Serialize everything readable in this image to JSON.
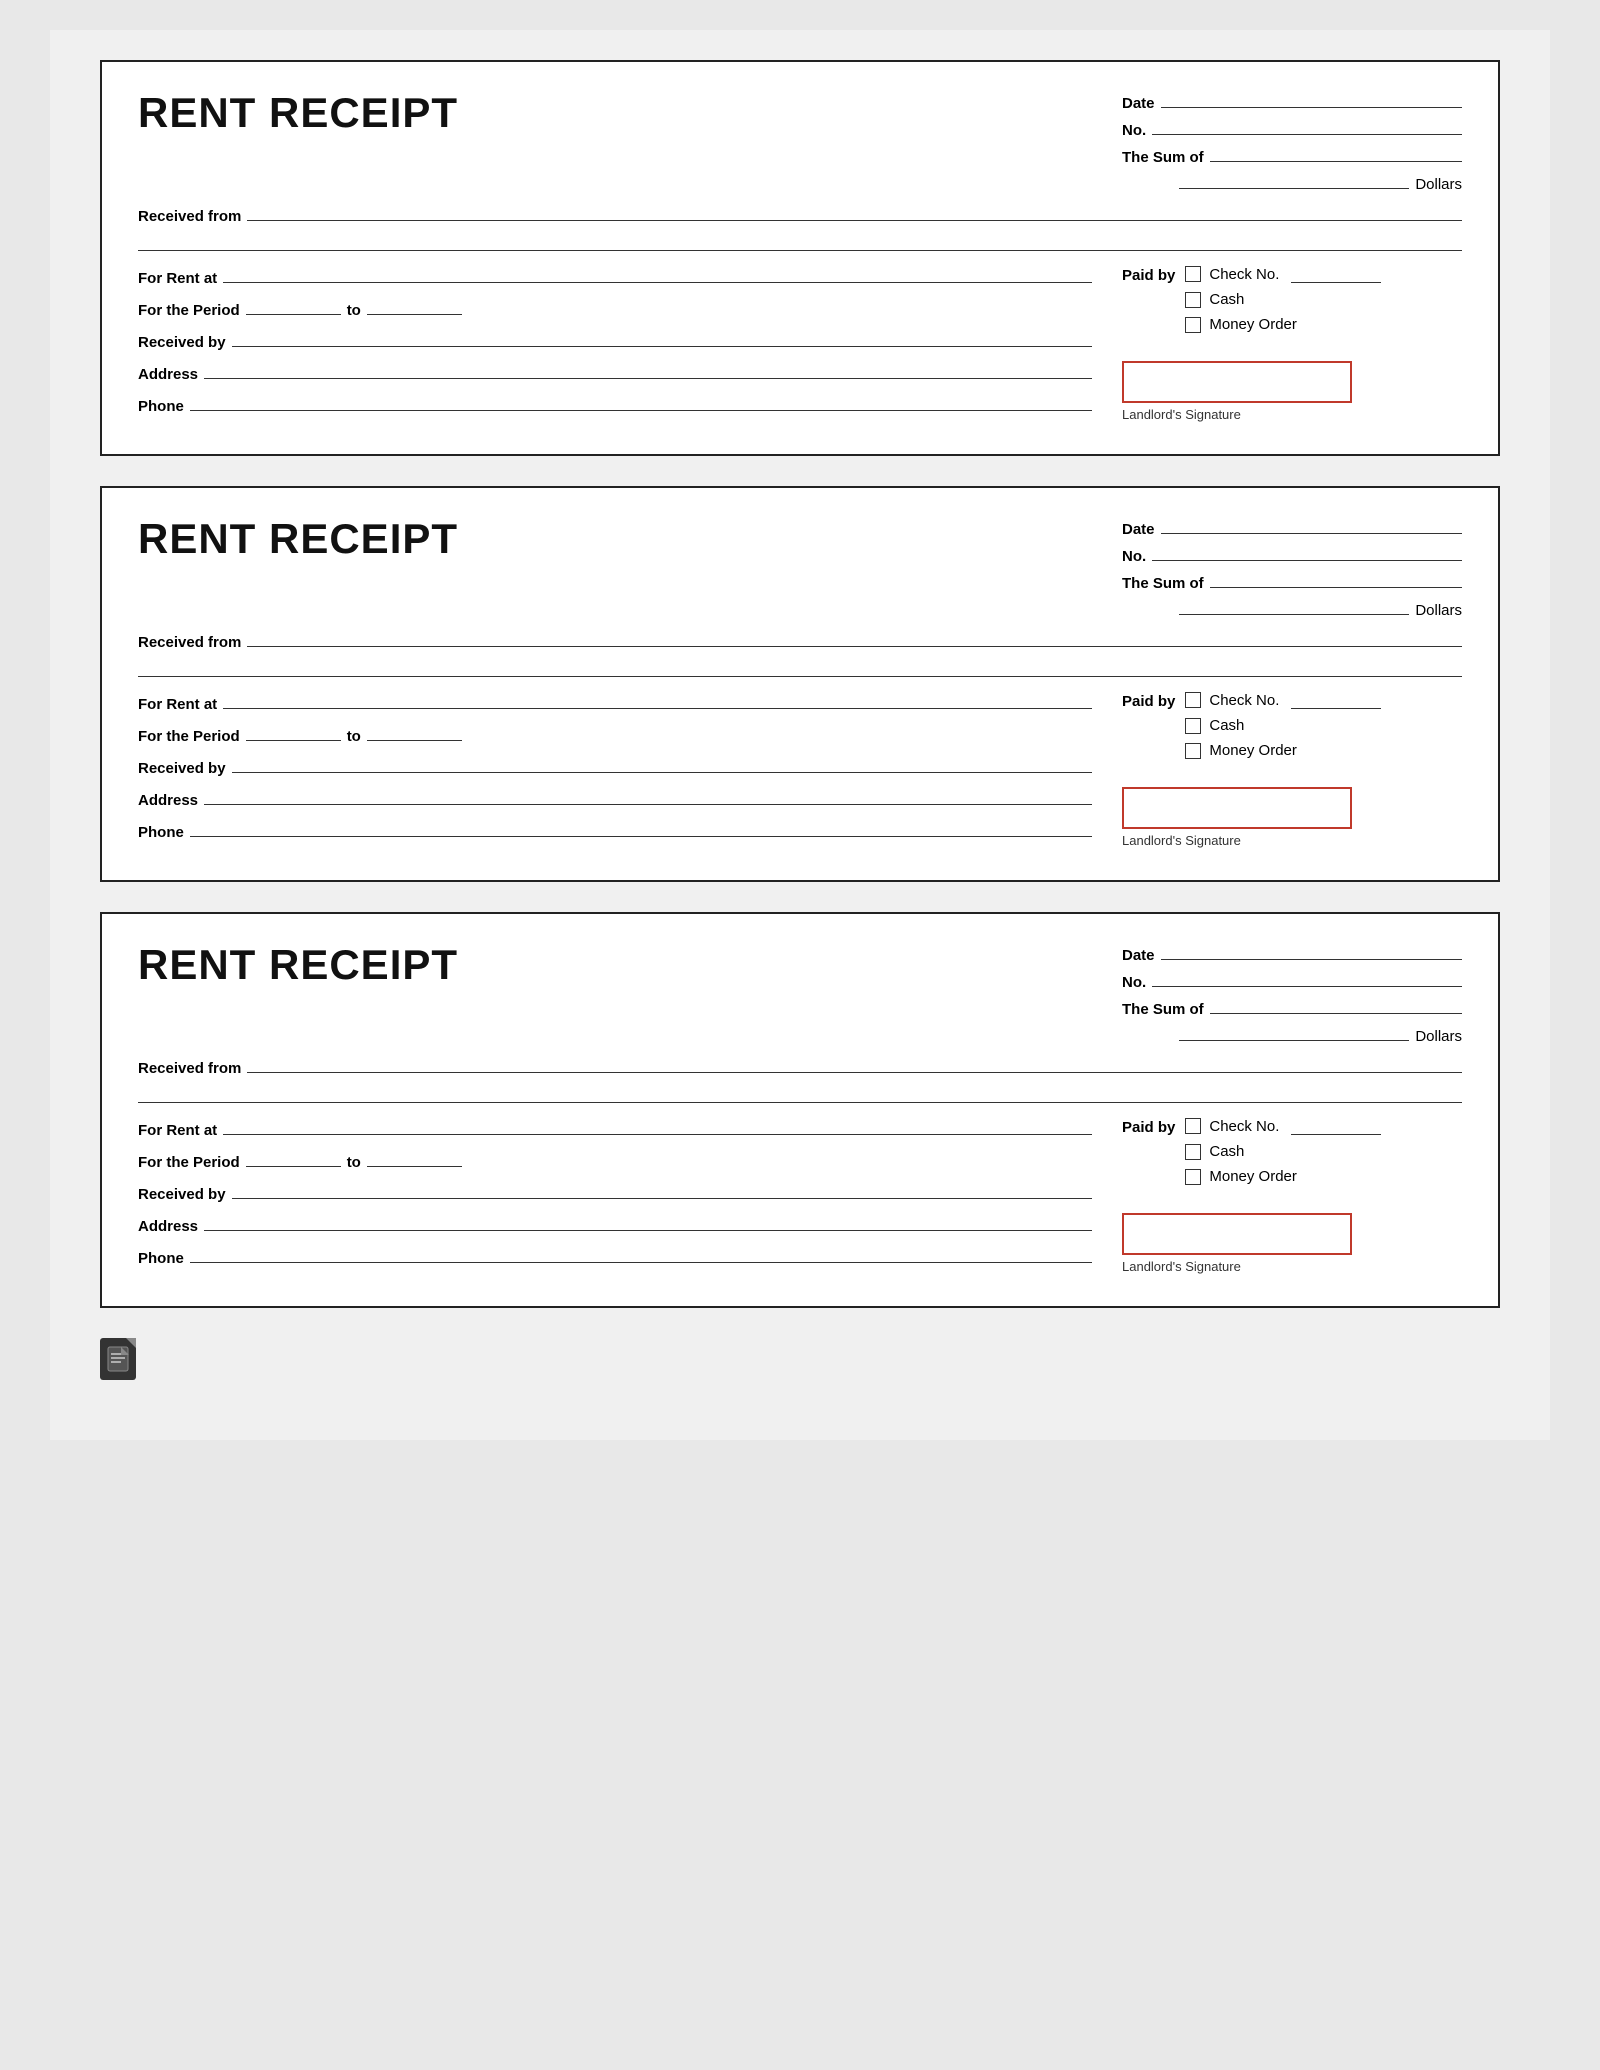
{
  "receipts": [
    {
      "id": 1,
      "title": "RENT RECEIPT",
      "date_label": "Date",
      "no_label": "No.",
      "sum_label": "The Sum of",
      "dollars_label": "Dollars",
      "received_from_label": "Received from",
      "for_rent_at_label": "For Rent at",
      "for_the_period_label": "For the Period",
      "to_label": "to",
      "received_by_label": "Received by",
      "address_label": "Address",
      "phone_label": "Phone",
      "paid_by_label": "Paid by",
      "check_no_label": "Check No.",
      "cash_label": "Cash",
      "money_order_label": "Money Order",
      "landlord_sig_label": "Landlord's Signature"
    },
    {
      "id": 2,
      "title": "RENT RECEIPT",
      "date_label": "Date",
      "no_label": "No.",
      "sum_label": "The Sum of",
      "dollars_label": "Dollars",
      "received_from_label": "Received from",
      "for_rent_at_label": "For Rent at",
      "for_the_period_label": "For the Period",
      "to_label": "to",
      "received_by_label": "Received by",
      "address_label": "Address",
      "phone_label": "Phone",
      "paid_by_label": "Paid by",
      "check_no_label": "Check No.",
      "cash_label": "Cash",
      "money_order_label": "Money Order",
      "landlord_sig_label": "Landlord's Signature"
    },
    {
      "id": 3,
      "title": "RENT RECEIPT",
      "date_label": "Date",
      "no_label": "No.",
      "sum_label": "The Sum of",
      "dollars_label": "Dollars",
      "received_from_label": "Received from",
      "for_rent_at_label": "For Rent at",
      "for_the_period_label": "For the Period",
      "to_label": "to",
      "received_by_label": "Received by",
      "address_label": "Address",
      "phone_label": "Phone",
      "paid_by_label": "Paid by",
      "check_no_label": "Check No.",
      "cash_label": "Cash",
      "money_order_label": "Money Order",
      "landlord_sig_label": "Landlord's Signature"
    }
  ],
  "footer_icon": "document-icon"
}
